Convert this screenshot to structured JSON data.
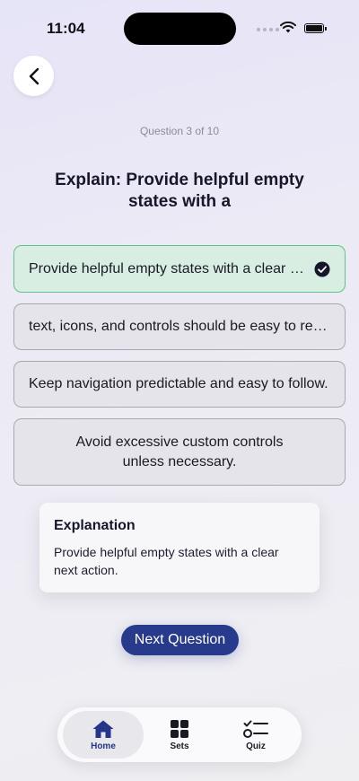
{
  "status": {
    "time": "11:04"
  },
  "quiz": {
    "counter": "Question 3 of 10",
    "question": "Explain: Provide helpful empty states with a",
    "options": [
      {
        "text": "Provide helpful empty states with a clear next action.",
        "state": "correct"
      },
      {
        "text": "text, icons, and controls should be easy to read.",
        "state": "default"
      },
      {
        "text": "Keep navigation predictable and easy to follow.",
        "state": "default"
      },
      {
        "text": "Avoid excessive custom controls\nunless necessary.",
        "state": "default"
      }
    ]
  },
  "explanation": {
    "title": "Explanation",
    "body": "Provide helpful empty states with a clear next action."
  },
  "actions": {
    "next_label": "Next Question"
  },
  "tabbar": {
    "items": [
      {
        "label": "Home",
        "icon": "home-icon",
        "active": true
      },
      {
        "label": "Sets",
        "icon": "grid-icon",
        "active": false
      },
      {
        "label": "Quiz",
        "icon": "checklist-icon",
        "active": false
      }
    ]
  },
  "colors": {
    "accent": "#283A8C",
    "correct_bg": "#D8EEE3",
    "correct_border": "#5CC58A"
  }
}
